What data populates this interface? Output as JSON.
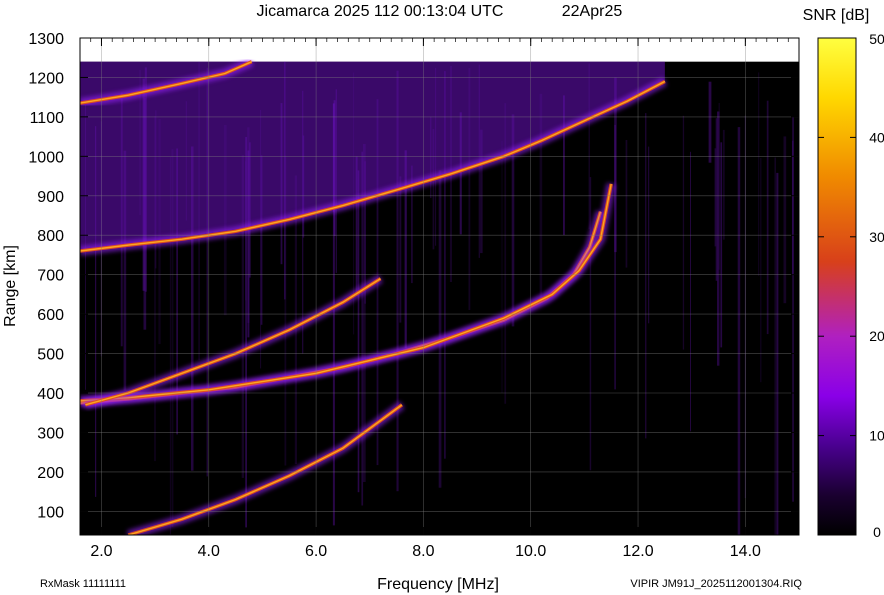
{
  "chart_data": {
    "type": "heatmap",
    "title": "Jicamarca 2025 112 00:13:04 UTC",
    "date_label": "22Apr25",
    "xlabel": "Frequency [MHz]",
    "ylabel": "Range [km]",
    "xlim": [
      1.6,
      15.0
    ],
    "ylim": [
      40,
      1300
    ],
    "x_ticks": [
      2.0,
      4.0,
      6.0,
      8.0,
      10.0,
      12.0,
      14.0
    ],
    "x_tick_labels": [
      "2.0",
      "4.0",
      "6.0",
      "8.0",
      "10.0",
      "12.0",
      "14.0"
    ],
    "y_ticks": [
      100,
      200,
      300,
      400,
      500,
      600,
      700,
      800,
      900,
      1000,
      1100,
      1200,
      1300
    ],
    "grid": true,
    "colorbar": {
      "label": "SNR [dB]",
      "min": 0,
      "max": 50,
      "ticks": [
        0,
        10,
        20,
        30,
        40,
        50
      ],
      "colors": [
        "#000000",
        "#3a0060",
        "#7a00d8",
        "#b020c8",
        "#d8402a",
        "#f07a08",
        "#ffd000",
        "#ffff30"
      ]
    },
    "traces": [
      {
        "points": [
          [
            1.6,
            375
          ],
          [
            2.5,
            385
          ],
          [
            3.5,
            400
          ],
          [
            4.5,
            415
          ],
          [
            5.5,
            440
          ],
          [
            6.5,
            465
          ],
          [
            7.5,
            500
          ],
          [
            8.5,
            540
          ],
          [
            9.5,
            585
          ],
          [
            10.3,
            640
          ],
          [
            10.8,
            700
          ],
          [
            11.1,
            770
          ],
          [
            11.3,
            860
          ]
        ]
      },
      {
        "points": [
          [
            1.6,
            380
          ],
          [
            2.5,
            388
          ],
          [
            4.0,
            408
          ],
          [
            6.0,
            450
          ],
          [
            8.0,
            515
          ],
          [
            9.5,
            590
          ],
          [
            10.4,
            650
          ],
          [
            10.9,
            710
          ],
          [
            11.3,
            790
          ],
          [
            11.5,
            930
          ]
        ]
      },
      {
        "points": [
          [
            1.7,
            370
          ],
          [
            2.5,
            400
          ],
          [
            3.5,
            450
          ],
          [
            4.5,
            500
          ],
          [
            5.5,
            560
          ],
          [
            6.5,
            630
          ],
          [
            7.2,
            690
          ]
        ]
      },
      {
        "points": [
          [
            2.5,
            40
          ],
          [
            3.5,
            80
          ],
          [
            4.5,
            130
          ],
          [
            5.5,
            190
          ],
          [
            6.5,
            260
          ],
          [
            7.2,
            330
          ],
          [
            7.6,
            370
          ]
        ]
      },
      {
        "points": [
          [
            1.6,
            760
          ],
          [
            2.5,
            775
          ],
          [
            3.5,
            790
          ],
          [
            4.5,
            810
          ],
          [
            5.5,
            840
          ],
          [
            6.5,
            875
          ],
          [
            7.5,
            915
          ],
          [
            8.5,
            955
          ],
          [
            9.5,
            1000
          ],
          [
            10.2,
            1040
          ],
          [
            11.0,
            1090
          ],
          [
            11.8,
            1140
          ],
          [
            12.5,
            1190
          ]
        ]
      },
      {
        "points": [
          [
            1.6,
            1135
          ],
          [
            2.5,
            1155
          ],
          [
            3.5,
            1185
          ],
          [
            4.3,
            1210
          ],
          [
            4.8,
            1240
          ]
        ]
      }
    ],
    "annotations": {
      "footer_left": "RxMask 11111111",
      "footer_right": "VIPIR  JM91J_2025112001304.RIQ"
    }
  }
}
